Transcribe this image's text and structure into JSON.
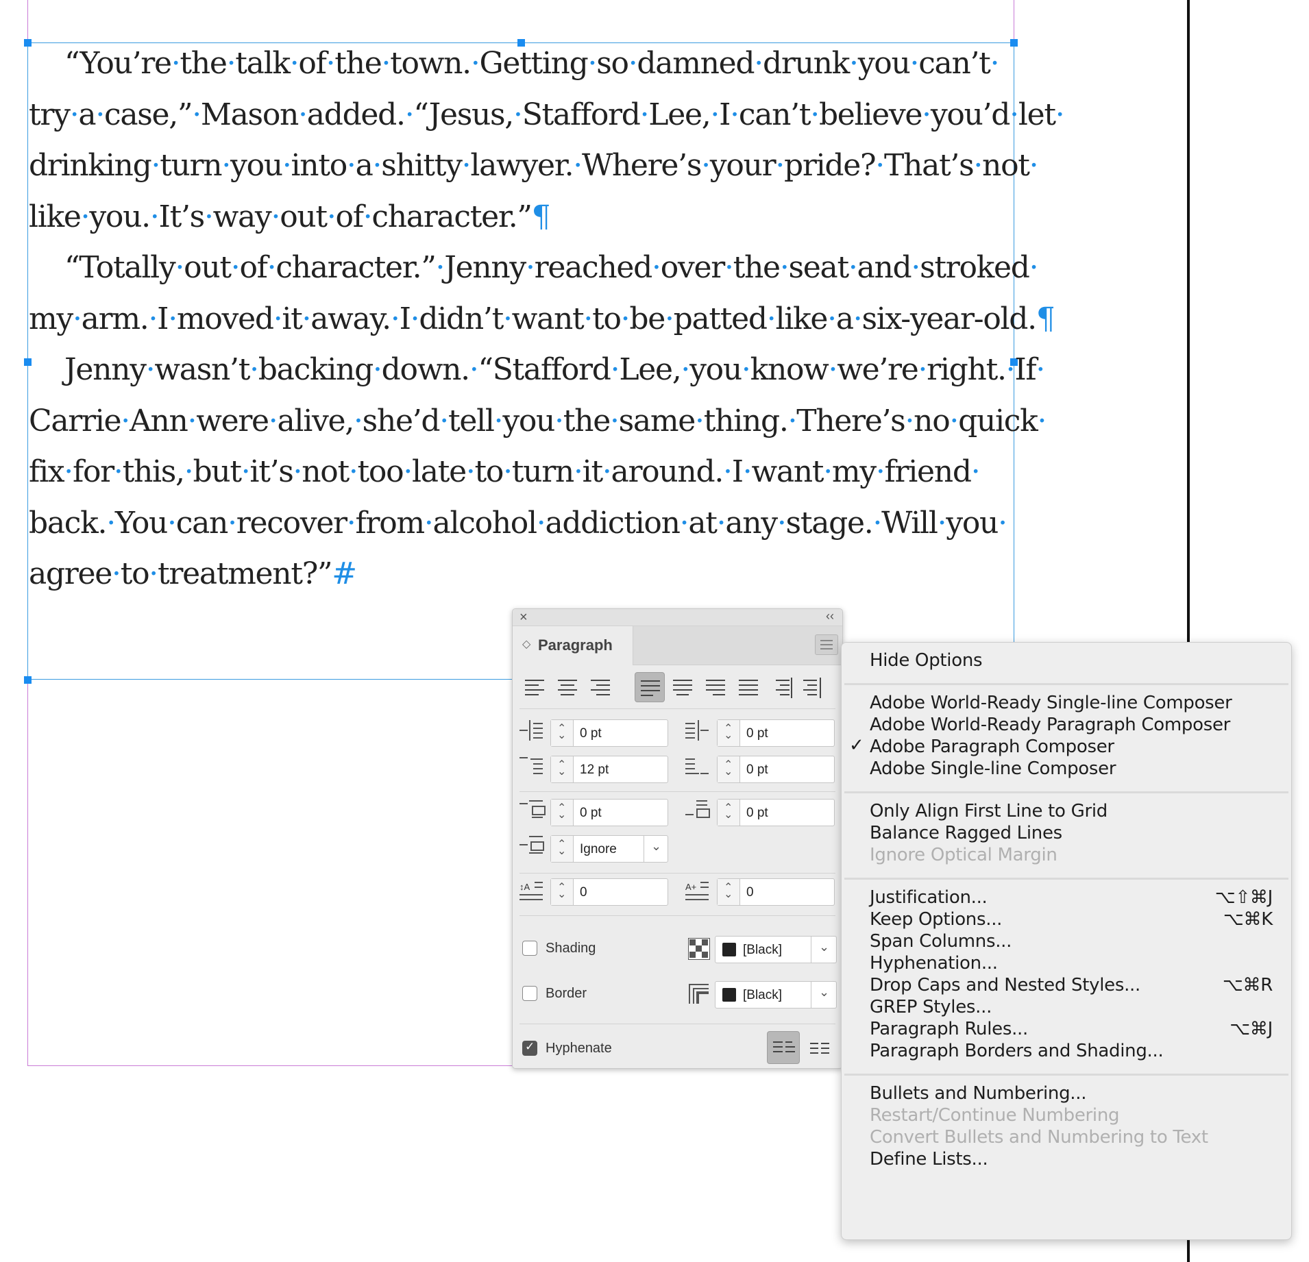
{
  "story": {
    "lines": [
      "“You’re·the·talk·of·the·town.·Getting·so·damned·drunk·you·can’t·",
      "try·a·case,”·Mason·added.·“Jesus,·Stafford·Lee,·I·can’t·believe·you’d·let·",
      "drinking·turn·you·into·a·shitty·lawyer.·Where’s·your·pride?·That’s·not·",
      "like·you.·It’s·way·out·of·character.”",
      "“Totally·out·of·character.”·Jenny·reached·over·the·seat·and·stroked·",
      "my·arm.·I·moved·it·away.·I·didn’t·want·to·be·patted·like·a·six-year-old.",
      "Jenny·wasn’t·backing·down.·“Stafford·Lee,·you·know·we’re·right.·If·",
      "Carrie·Ann·were·alive,·she’d·tell·you·the·same·thing.·There’s·no·quick·",
      "fix·for·this,·but·it’s·not·too·late·to·turn·it·around.·I·want·my·friend·",
      "back.·You·can·recover·from·alcohol·addiction·at·any·stage.·Will·you·",
      "agree·to·treatment?”"
    ],
    "pilcrow": "¶",
    "end_mark": "#"
  },
  "panel": {
    "close_glyph": "×",
    "collapse_glyph": "‹‹",
    "tab_chevron": "◇",
    "tab_label": "Paragraph",
    "left_indent": "0 pt",
    "right_indent": "0 pt",
    "first_line_indent": "12 pt",
    "last_line_right_indent": "0 pt",
    "space_before": "0 pt",
    "space_after": "0 pt",
    "align_to_grid": "Ignore",
    "drop_cap_lines": "0",
    "drop_cap_chars": "0",
    "shading_label": "Shading",
    "shading_color": "[Black]",
    "border_label": "Border",
    "border_color": "[Black]",
    "hyphenate_label": "Hyphenate",
    "shading_checked": false,
    "border_checked": false,
    "hyphenate_checked": true
  },
  "menu": {
    "hide_options": "Hide Options",
    "composers": [
      "Adobe World-Ready Single-line Composer",
      "Adobe World-Ready Paragraph Composer",
      "Adobe Paragraph Composer",
      "Adobe Single-line Composer"
    ],
    "checked_glyph": "✓",
    "grid": [
      "Only Align First Line to Grid",
      "Balance Ragged Lines",
      "Ignore Optical Margin"
    ],
    "dialogs": [
      {
        "label": "Justification...",
        "shortcut": "⌥⇧⌘J"
      },
      {
        "label": "Keep Options...",
        "shortcut": "⌥⌘K"
      },
      {
        "label": "Span Columns...",
        "shortcut": ""
      },
      {
        "label": "Hyphenation...",
        "shortcut": ""
      },
      {
        "label": "Drop Caps and Nested Styles...",
        "shortcut": "⌥⌘R"
      },
      {
        "label": "GREP Styles...",
        "shortcut": ""
      },
      {
        "label": "Paragraph Rules...",
        "shortcut": "⌥⌘J"
      },
      {
        "label": "Paragraph Borders and Shading...",
        "shortcut": ""
      }
    ],
    "lists": [
      "Bullets and Numbering...",
      "Restart/Continue Numbering",
      "Convert Bullets and Numbering to Text",
      "Define Lists..."
    ]
  },
  "colors": {
    "frame_blue": "#1a8cf0",
    "margin_magenta": "#c97ad6",
    "hidden_char_blue": "#1f8ee6",
    "menu_disabled": "#b0b0b0"
  }
}
